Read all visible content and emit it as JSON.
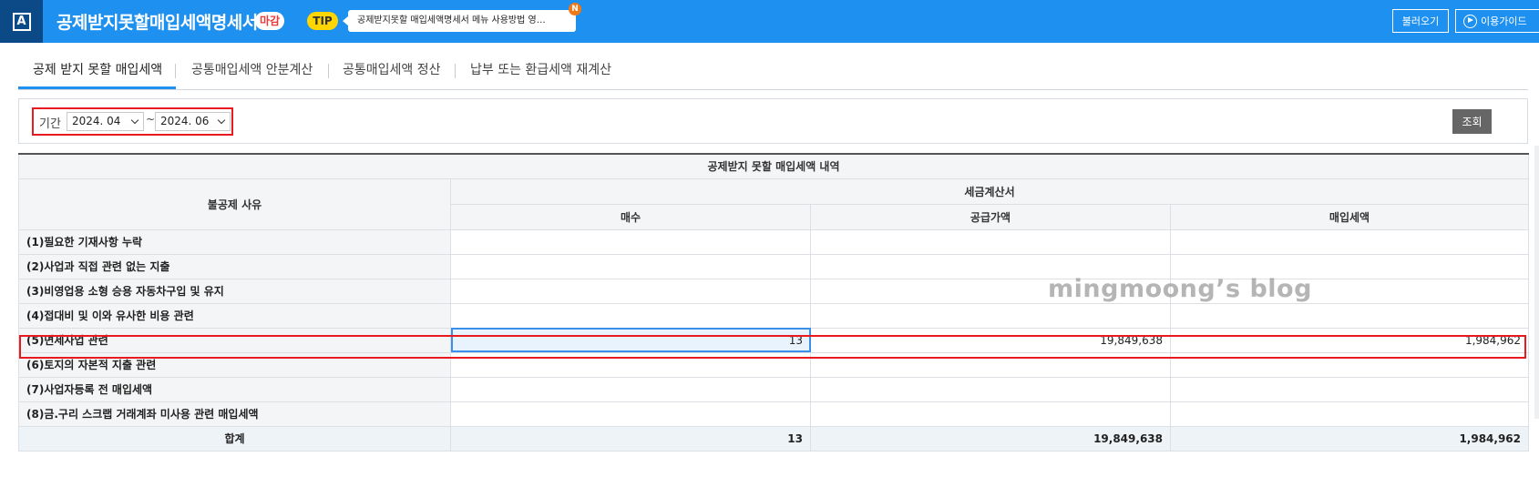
{
  "header": {
    "logo_letter": "A",
    "title": "공제받지못할매입세액명세서",
    "status_badge": "마감",
    "tip_label": "TIP",
    "tip_text": "공제받지못할 매입세액명세서 메뉴 사용방법 영…",
    "new_badge": "N",
    "load_button": "불러오기",
    "guide_button": "이용가이드"
  },
  "tabs": [
    {
      "label": "공제 받지 못할 매입세액",
      "active": true
    },
    {
      "label": "공통매입세액 안분계산",
      "active": false
    },
    {
      "label": "공통매입세액 정산",
      "active": false
    },
    {
      "label": "납부 또는 환급세액 재계산",
      "active": false
    }
  ],
  "filter": {
    "period_label": "기간",
    "start": "2024. 04",
    "separator": "~",
    "end": "2024. 06",
    "search_button": "조회"
  },
  "table": {
    "title": "공제받지 못할 매입세액 내역",
    "reason_header": "불공제 사유",
    "group_header": "세금계산서",
    "columns": [
      "매수",
      "공급가액",
      "매입세액"
    ],
    "rows": [
      {
        "reason": "(1)필요한 기재사항 누락",
        "count": "",
        "supply": "",
        "tax": ""
      },
      {
        "reason": "(2)사업과 직접 관련 없는 지출",
        "count": "",
        "supply": "",
        "tax": ""
      },
      {
        "reason": "(3)비영업용 소형 승용 자동차구입 및 유지",
        "count": "",
        "supply": "",
        "tax": ""
      },
      {
        "reason": "(4)접대비 및 이와 유사한 비용 관련",
        "count": "",
        "supply": "",
        "tax": ""
      },
      {
        "reason": "(5)면세사업 관련",
        "count": "13",
        "supply": "19,849,638",
        "tax": "1,984,962"
      },
      {
        "reason": "(6)토지의 자본적 지출 관련",
        "count": "",
        "supply": "",
        "tax": ""
      },
      {
        "reason": "(7)사업자등록 전 매입세액",
        "count": "",
        "supply": "",
        "tax": ""
      },
      {
        "reason": "(8)금.구리 스크랩 거래계좌 미사용 관련 매입세액",
        "count": "",
        "supply": "",
        "tax": ""
      }
    ],
    "total": {
      "label": "합계",
      "count": "13",
      "supply": "19,849,638",
      "tax": "1,984,962"
    }
  },
  "watermark": "mingmoong’s blog",
  "colors": {
    "header_bg": "#1e90f0",
    "logo_bg": "#0b4a86",
    "highlight": "#e8191f",
    "active_tab": "#1e90f0"
  }
}
